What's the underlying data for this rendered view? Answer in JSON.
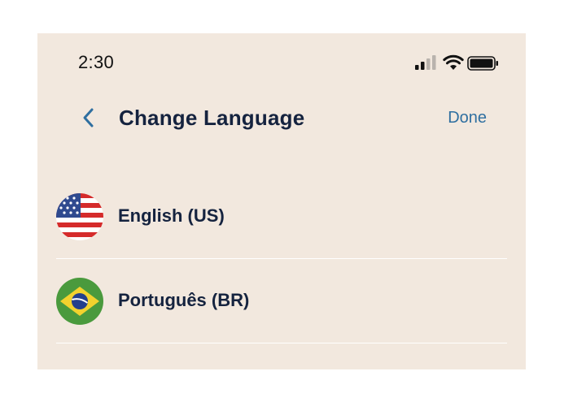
{
  "status_bar": {
    "time": "2:30",
    "icons": [
      "cellular-signal-icon",
      "wifi-icon",
      "battery-icon"
    ]
  },
  "nav": {
    "back_icon": "chevron-left-icon",
    "title": "Change Language",
    "done_label": "Done"
  },
  "languages": [
    {
      "label": "English (US)",
      "flag_icon": "us-flag-icon"
    },
    {
      "label": "Português (BR)",
      "flag_icon": "brazil-flag-icon"
    }
  ],
  "colors": {
    "background": "#f2e8de",
    "title_text": "#15233f",
    "accent": "#2f6fa0",
    "separator": "#ffffff"
  }
}
